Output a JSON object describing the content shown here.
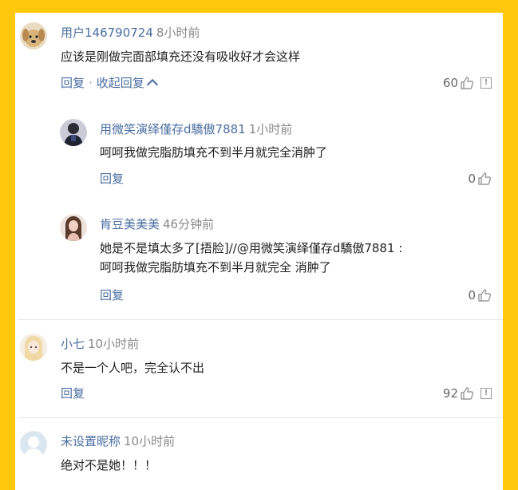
{
  "comments": [
    {
      "user": "用户146790724",
      "time": "8小时前",
      "text": "应该是刚做完面部填充还没有吸收好才会这样",
      "reply_label": "回复",
      "collapse_label": "收起回复",
      "likes": "60",
      "avatar_icon": "dog-avatar"
    },
    {
      "user": "用微笑演绎僅存d驕傲7881",
      "time": "1小时前",
      "text": "呵呵我做完脂肪填充不到半月就完全消肿了",
      "reply_label": "回复",
      "likes": "0",
      "avatar_icon": "person-dark-avatar"
    },
    {
      "user": "肯豆美美美",
      "time": "46分钟前",
      "text_line1": "她是不是填太多了[捂脸]//@用微笑演绎僅存d驕傲7881 :",
      "text_line2": "呵呵我做完脂肪填充不到半月就完全 消肿了",
      "reply_label": "回复",
      "likes": "0",
      "avatar_icon": "girl-avatar"
    },
    {
      "user": "小七",
      "time": "10小时前",
      "text": "不是一个人吧，完全认不出",
      "reply_label": "回复",
      "likes": "92",
      "avatar_icon": "anime-girl-avatar"
    },
    {
      "user": "未设置昵称",
      "time": "10小时前",
      "text": "绝对不是她！！！",
      "avatar_icon": "default-avatar"
    }
  ],
  "icons": {
    "like": "thumbs-up-icon",
    "report": "report-icon"
  },
  "colors": {
    "background": "#ffc80a",
    "username": "#4a6da0",
    "text": "#222222"
  }
}
